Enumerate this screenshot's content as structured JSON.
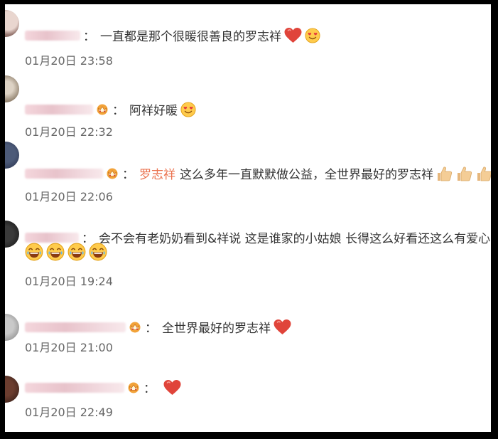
{
  "comments": [
    {
      "text": "一直都是那个很暖很善良的罗志祥",
      "time": "01月20日 23:58"
    },
    {
      "text": "阿祥好暖",
      "time": "01月20日 22:32"
    },
    {
      "mention": "罗志祥",
      "text": "这么多年一直默默做公益，全世界最好的罗志祥",
      "time": "01月20日 22:06"
    },
    {
      "text": "会不会有老奶奶看到&祥说 这是谁家的小姑娘 长得这么好看还这么有爱心",
      "time": "01月20日 19:24"
    },
    {
      "text": "全世界最好的罗志祥",
      "time": "01月20日 21:00"
    },
    {
      "text": "",
      "time": "01月20日 22:49"
    }
  ],
  "colon": "：",
  "vip_badge": "v",
  "icons": [
    "heart-icon",
    "heart-eyes-icon",
    "thumbs-up-icon",
    "laughing-emoji-icon",
    "vip-crown-icon"
  ],
  "colors": {
    "mention": "#eb7350",
    "heart": "#e0443a",
    "time": "#666666"
  }
}
